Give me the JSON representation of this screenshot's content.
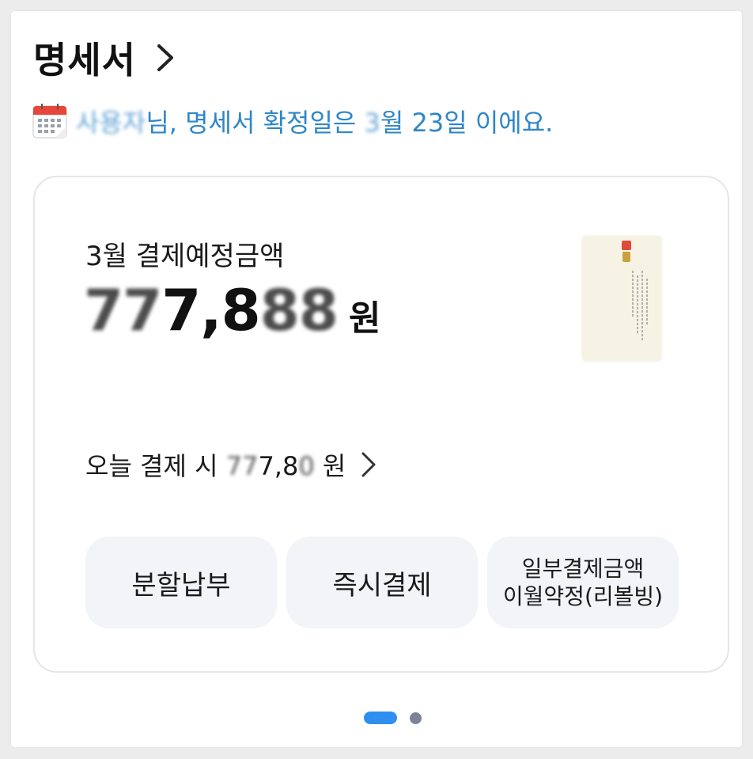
{
  "header": {
    "title": "명세서",
    "chevron_icon": "chevron-right-icon"
  },
  "notice": {
    "icon": "calendar-icon",
    "name_masked": "사용자",
    "text_mid": "님, 명세서 확정일은 ",
    "month_masked": "3",
    "text_end": "월 23일 이에요.",
    "color": "#2f86c8"
  },
  "card": {
    "due_label": "3월 결제예정금액",
    "amount_hidden_prefix": "77",
    "amount_visible": "7,8",
    "amount_hidden_suffix": "88",
    "amount_unit": "원",
    "today_prefix": "오늘 결제 시 ",
    "today_hidden": "77",
    "today_visible": "7,8",
    "today_hidden_suffix": "0",
    "today_unit": " 원",
    "today_chevron_icon": "chevron-right-icon"
  },
  "actions": {
    "installment": "분할납부",
    "instant_pay": "즉시결제",
    "revolving_line1": "일부결제금액",
    "revolving_line2": "이월약정(리볼빙)"
  },
  "pagination": {
    "current_page": 1,
    "total_pages": 2,
    "active_color": "#2f8ff0"
  }
}
